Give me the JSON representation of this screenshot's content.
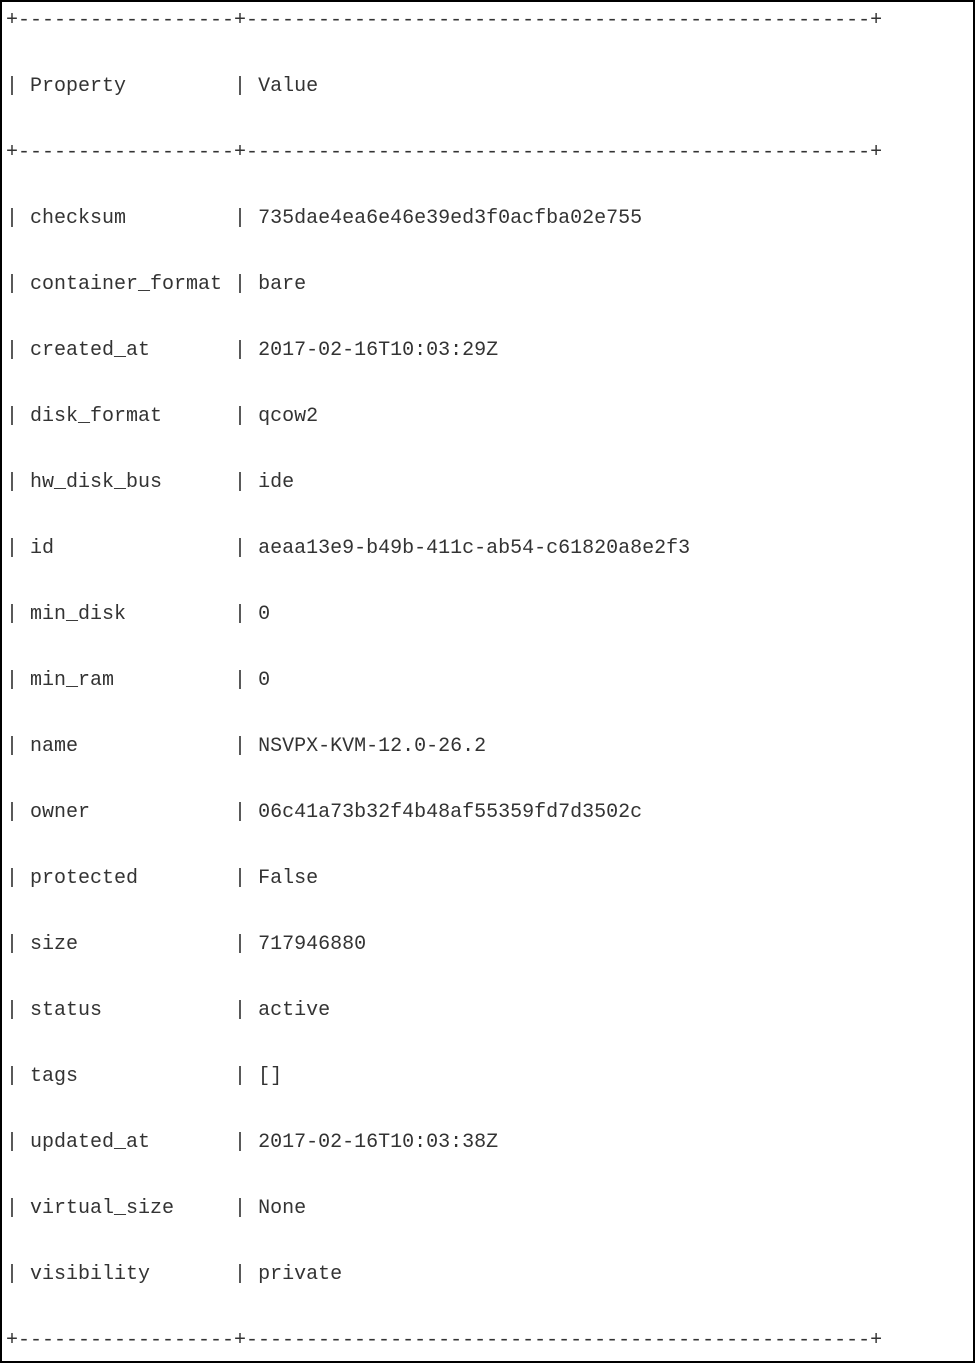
{
  "table": {
    "border_top": "+------------------+----------------------------------------------------+",
    "border_mid": "+------------------+----------------------------------------------------+",
    "border_bot": "+------------------+----------------------------------------------------+",
    "header_property": "Property",
    "header_value": "Value",
    "rows": [
      {
        "property": "checksum",
        "value": "735dae4ea6e46e39ed3f0acfba02e755"
      },
      {
        "property": "container_format",
        "value": "bare"
      },
      {
        "property": "created_at",
        "value": "2017-02-16T10:03:29Z"
      },
      {
        "property": "disk_format",
        "value": "qcow2"
      },
      {
        "property": "hw_disk_bus",
        "value": "ide"
      },
      {
        "property": "id",
        "value": "aeaa13e9-b49b-411c-ab54-c61820a8e2f3"
      },
      {
        "property": "min_disk",
        "value": "0"
      },
      {
        "property": "min_ram",
        "value": "0"
      },
      {
        "property": "name",
        "value": "NSVPX-KVM-12.0-26.2"
      },
      {
        "property": "owner",
        "value": "06c41a73b32f4b48af55359fd7d3502c"
      },
      {
        "property": "protected",
        "value": "False"
      },
      {
        "property": "size",
        "value": "717946880"
      },
      {
        "property": "status",
        "value": "active"
      },
      {
        "property": "tags",
        "value": "[]"
      },
      {
        "property": "updated_at",
        "value": "2017-02-16T10:03:38Z"
      },
      {
        "property": "virtual_size",
        "value": "None"
      },
      {
        "property": "visibility",
        "value": "private"
      }
    ]
  }
}
